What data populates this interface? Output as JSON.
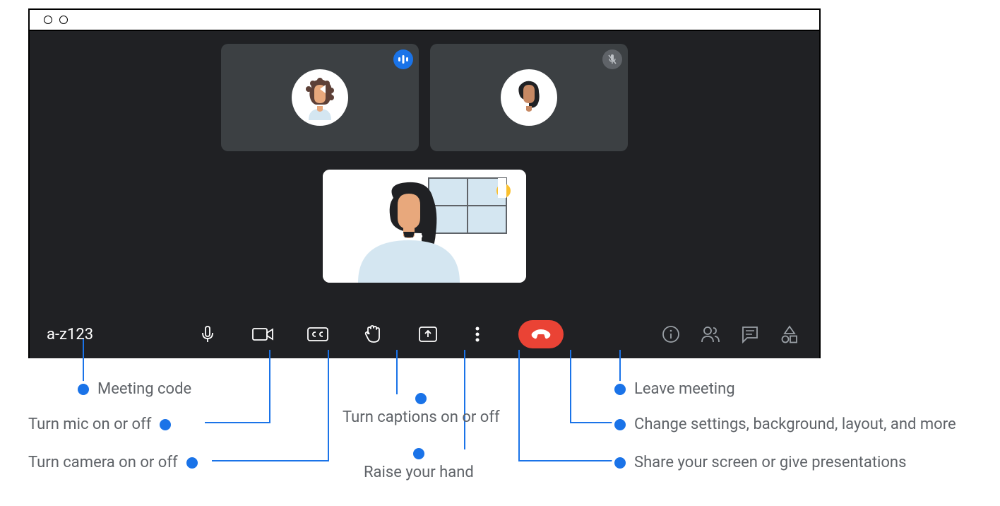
{
  "meeting": {
    "code": "a-z123"
  },
  "callouts": {
    "meeting_code": "Meeting code",
    "mic": "Turn mic on or off",
    "camera": "Turn camera on or off",
    "captions": "Turn captions on or off",
    "raise_hand": "Raise your hand",
    "share_screen": "Share your screen or give presentations",
    "more_options": "Change settings, background, layout, and more",
    "leave": "Leave meeting"
  },
  "participants": {
    "tile1_status": "speaking",
    "tile2_status": "muted"
  }
}
